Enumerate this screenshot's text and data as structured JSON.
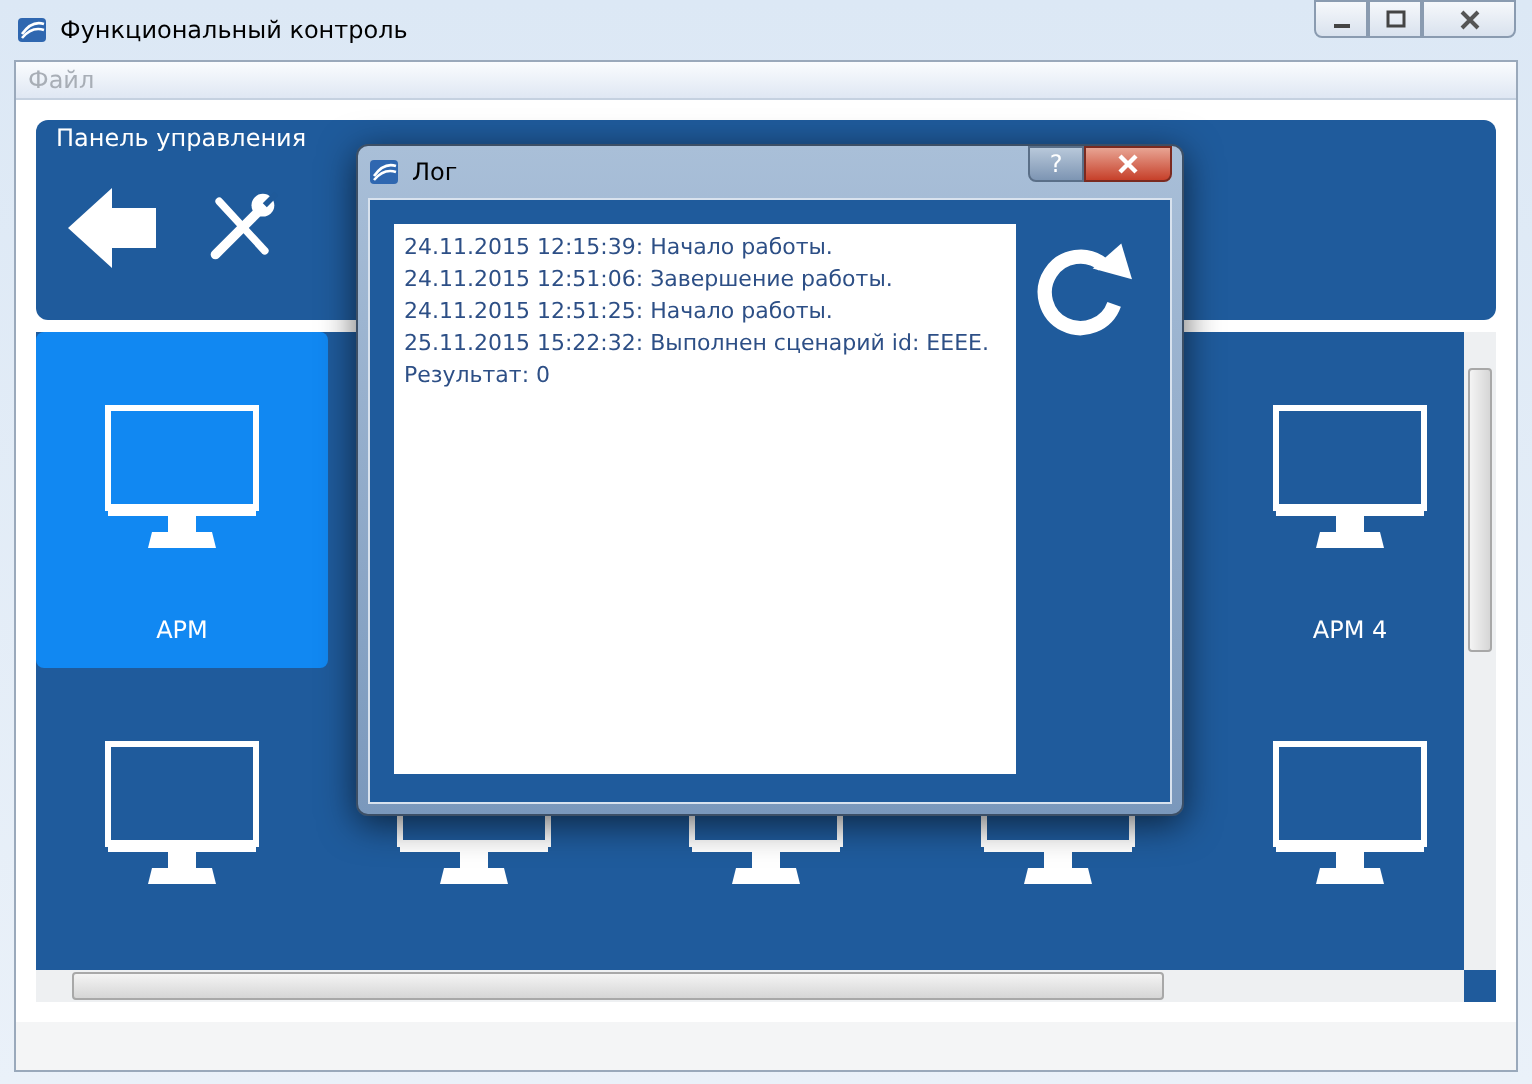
{
  "window": {
    "title": "Функциональный контроль"
  },
  "menu": [
    {
      "label": "Файл",
      "disabled": true
    }
  ],
  "control_panel": {
    "title": "Панель управления"
  },
  "workstations": [
    {
      "label": "АРМ",
      "selected": true
    },
    {
      "label": "АРМ 4",
      "selected": false
    },
    {
      "selected": false
    },
    {
      "selected": false
    },
    {
      "selected": false
    },
    {
      "selected": false
    },
    {
      "selected": false
    }
  ],
  "log_dialog": {
    "title": "Лог",
    "help_button": "?",
    "lines": [
      "24.11.2015 12:15:39: Начало работы.",
      "24.11.2015 12:51:06: Завершение работы.",
      "24.11.2015 12:51:25: Начало работы.",
      "25.11.2015 15:22:32: Выполнен сценарий id: EEEE.",
      "Результат: 0"
    ]
  }
}
